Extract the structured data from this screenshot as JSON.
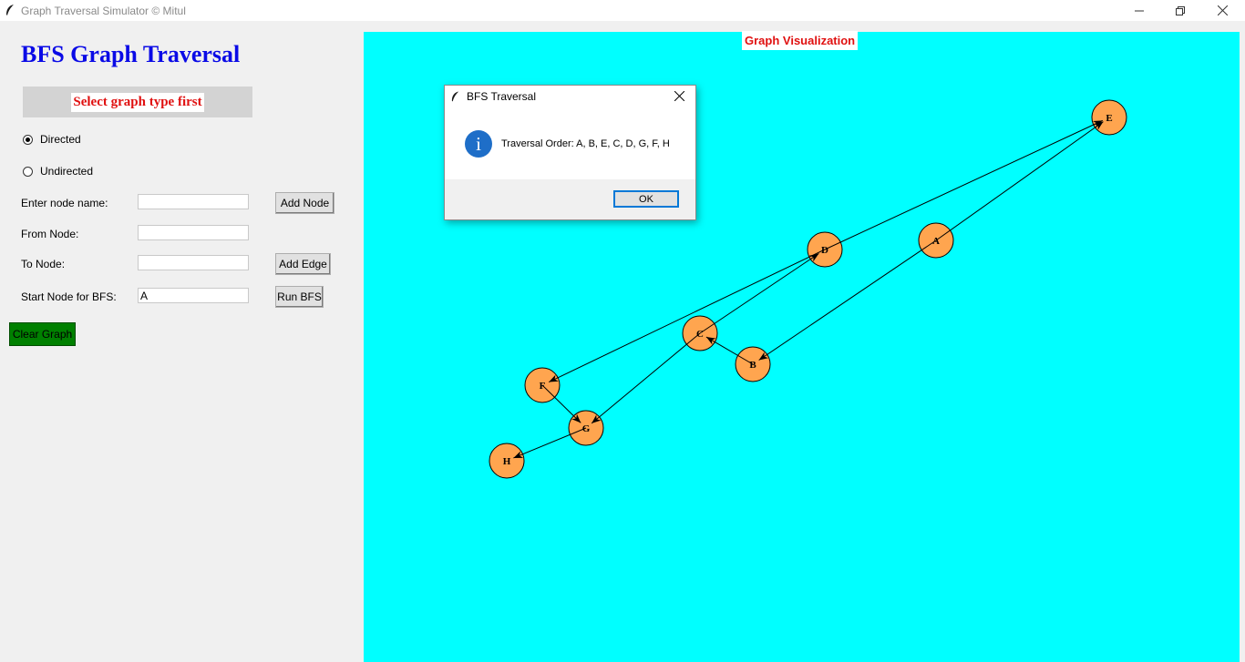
{
  "window": {
    "title": "Graph Traversal Simulator © Mitul"
  },
  "heading": "BFS Graph Traversal",
  "status": "Select graph type first",
  "graph_type": {
    "options": [
      {
        "label": "Directed",
        "checked": true
      },
      {
        "label": "Undirected",
        "checked": false
      }
    ]
  },
  "form": {
    "node_name_label": "Enter node name:",
    "node_name_value": "",
    "add_node_label": "Add Node",
    "from_label": "From Node:",
    "from_value": "",
    "to_label": "To Node:",
    "to_value": "",
    "add_edge_label": "Add Edge",
    "start_label": "Start Node for BFS:",
    "start_value": "A",
    "run_label": "Run BFS",
    "clear_label": "Clear Graph"
  },
  "canvas": {
    "title": "Graph Visualization",
    "background": "#00ffff",
    "node_color": "#ffa54f",
    "nodes": [
      "A",
      "B",
      "C",
      "D",
      "E",
      "F",
      "G",
      "H"
    ],
    "edges": [
      {
        "from": "A",
        "to": "B"
      },
      {
        "from": "A",
        "to": "E"
      },
      {
        "from": "B",
        "to": "C"
      },
      {
        "from": "C",
        "to": "D"
      },
      {
        "from": "C",
        "to": "G"
      },
      {
        "from": "D",
        "to": "E"
      },
      {
        "from": "D",
        "to": "F"
      },
      {
        "from": "F",
        "to": "G"
      },
      {
        "from": "G",
        "to": "H"
      }
    ]
  },
  "dialog": {
    "title": "BFS Traversal",
    "message": "Traversal Order: A, B, E, C, D, G, F, H",
    "ok_label": "OK",
    "icon": "info-icon",
    "icon_glyph": "i"
  }
}
